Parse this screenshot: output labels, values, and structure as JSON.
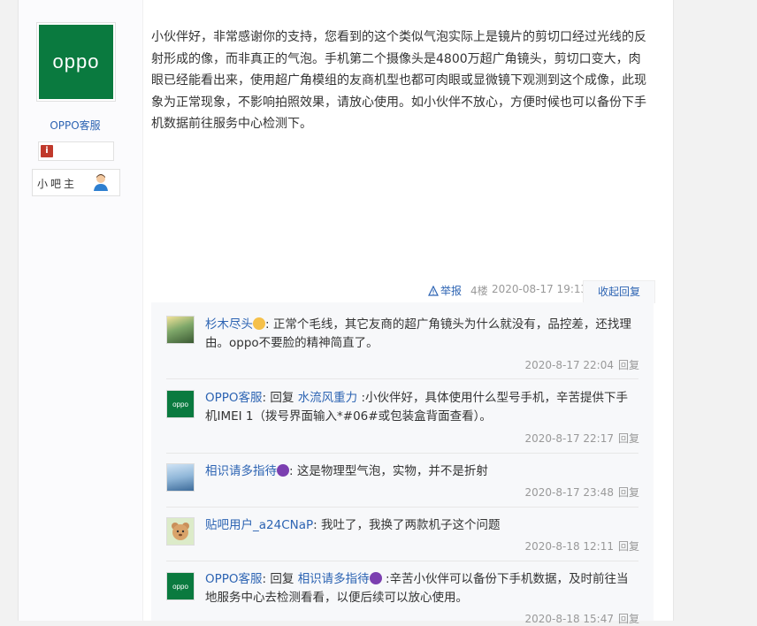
{
  "post": {
    "author": {
      "name": "OPPO客服",
      "avatar_text": "oppo",
      "role": "小吧主",
      "brand_color": "#0a7a3f"
    },
    "content": "小伙伴好，非常感谢你的支持，您看到的这个类似气泡实际上是镜片的剪切口经过光线的反射形成的像，而非真正的气泡。手机第二个摄像头是4800万超广角镜头，剪切口变大，肉眼已经能看出来，使用超广角模组的友商机型也都可肉眼或显微镜下观测到这个成像，此现象为正常现象，不影响拍照效果，请放心使用。如小伙伴不放心，方便时候也可以备份下手机数据前往服务中心检测下。",
    "tail": {
      "report": "举报",
      "floor": "4楼",
      "time": "2020-08-17 19:13",
      "collapse": "收起回复"
    }
  },
  "replies": [
    {
      "name": "杉木尽头",
      "emoji": "smile",
      "text": ": 正常个毛线，其它友商的超广角镜头为什么就没有，品控差，还找理由。oppo不要脸的精神简直了。",
      "time": "2020-8-17 22:04",
      "reply": "回复"
    },
    {
      "name": "OPPO客服",
      "prefix": ": 回复 ",
      "target": "水流风重力",
      "text": " :小伙伴好，具体使用什么型号手机，辛苦提供下手机IMEI 1（拨号界面输入*#06#或包装盒背面查看）。",
      "time": "2020-8-17 22:17",
      "reply": "回复"
    },
    {
      "name": "相识请多指待",
      "emoji": "devil",
      "text": ": 这是物理型气泡，实物，并不是折射",
      "time": "2020-8-17 23:48",
      "reply": "回复"
    },
    {
      "name": "贴吧用户_a24CNaP",
      "text": ": 我吐了，我换了两款机子这个问题",
      "time": "2020-8-18 12:11",
      "reply": "回复"
    },
    {
      "name": "OPPO客服",
      "prefix": ": 回复 ",
      "target": "相识请多指待",
      "emoji": "devil",
      "text": " :辛苦小伙伴可以备份下手机数据，及时前往当地服务中心去检测看看，以便后续可以放心使用。",
      "time": "2020-8-18 15:47",
      "reply": "回复"
    }
  ],
  "colors": {
    "link": "#2d64b3",
    "meta": "#999999",
    "reply_bg": "#f7f8fa"
  }
}
